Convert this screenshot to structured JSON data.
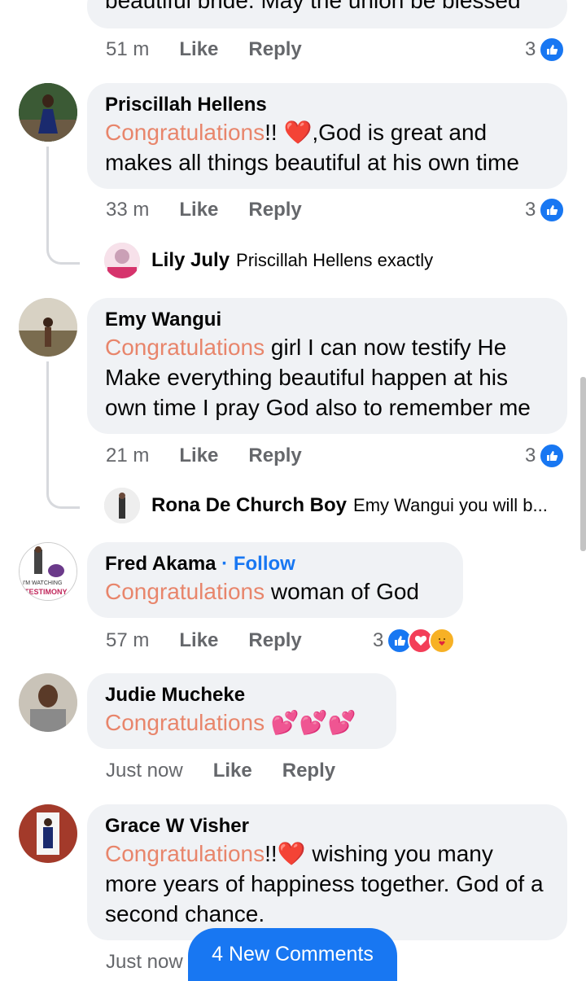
{
  "colors": {
    "accent": "#1877f2",
    "congrats": "#e8856b",
    "bubble": "#f0f2f5",
    "meta": "#65676b"
  },
  "actions": {
    "like": "Like",
    "reply": "Reply"
  },
  "top_comment": {
    "text_tail": "beautiful bride. May the union be blessed",
    "time": "51 m",
    "reaction_count": "3"
  },
  "comments": [
    {
      "name": "Priscillah Hellens",
      "congrats": "Congratulations",
      "rest": "!! ❤️,God is great and makes all things beautiful at his own time",
      "time": "33 m",
      "reaction_count": "3",
      "reply": {
        "name": "Lily July",
        "text": "Priscillah Hellens exactly"
      }
    },
    {
      "name": "Emy Wangui",
      "congrats": "Congratulations",
      "rest": " girl   I can now testify He Make  everything beautiful happen at his own time I pray God also to remember me",
      "time": "21 m",
      "reaction_count": "3",
      "reply": {
        "name": "Rona De Church Boy",
        "text": "Emy Wangui you will b..."
      }
    },
    {
      "name": "Fred Akama",
      "follow": "· Follow",
      "congrats": "Congratulations",
      "rest": " woman of God",
      "time": "57 m",
      "reaction_count": "3",
      "avatar_caption_1": "I'M WATCHING",
      "avatar_caption_2": "TESTIMONY"
    },
    {
      "name": "Judie Mucheke",
      "congrats": "Congratulations",
      "rest": " 💕💕💕",
      "time": "Just now"
    },
    {
      "name": "Grace W Visher",
      "congrats": "Congratulations",
      "rest": "!!❤️ wishing you many more years of happiness together. God of a second chance.",
      "time": "Just now"
    }
  ],
  "new_comments_button": "4 New Comments"
}
